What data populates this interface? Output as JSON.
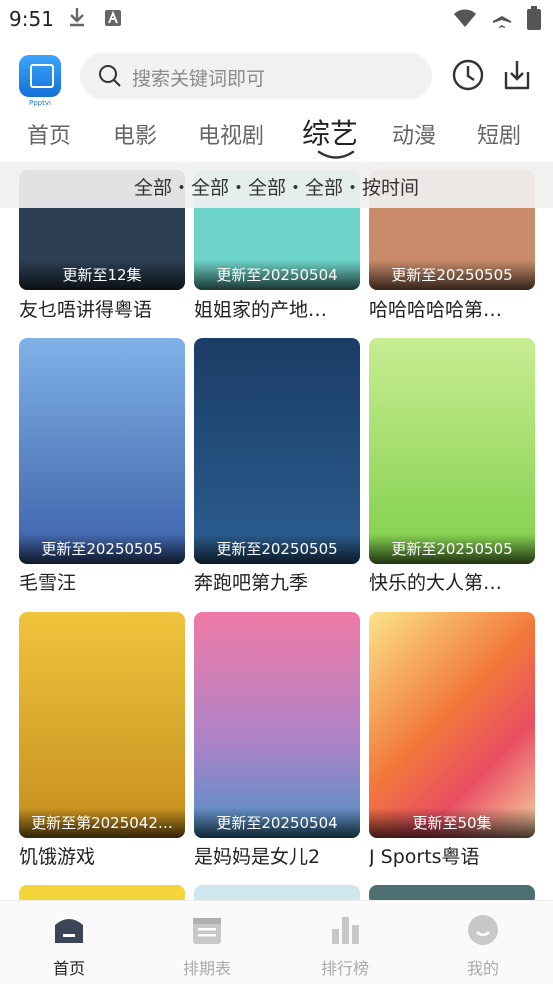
{
  "status": {
    "time": "9:51"
  },
  "header": {
    "logo_caption": "Ppptvi",
    "search_placeholder": "搜索关键词即可"
  },
  "tabs": [
    {
      "label": "首页",
      "active": false
    },
    {
      "label": "电影",
      "active": false
    },
    {
      "label": "电视剧",
      "active": false
    },
    {
      "label": "综艺",
      "active": true
    },
    {
      "label": "动漫",
      "active": false
    },
    {
      "label": "短剧",
      "active": false
    }
  ],
  "filter": {
    "text": "全部・全部・全部・全部・按时间"
  },
  "rows": [
    [
      {
        "badge": "更新至12集",
        "title": "友乜唔讲得粤语",
        "color": "#2d3f55"
      },
      {
        "badge": "更新至20250504",
        "title": "姐姐家的产地…",
        "color": "#6dd3c8"
      },
      {
        "badge": "更新至20250505",
        "title": "哈哈哈哈哈第…",
        "color": "#c98b6a"
      }
    ],
    [
      {
        "badge": "更新至20250505",
        "title": "毛雪汪",
        "color": "#5a86c8"
      },
      {
        "badge": "更新至20250505",
        "title": "奔跑吧第九季",
        "color": "#1c3b63"
      },
      {
        "badge": "更新至20250505",
        "title": "快乐的大人第…",
        "color": "#8ed64d"
      }
    ],
    [
      {
        "badge": "更新至第2025042…",
        "title": "饥饿游戏",
        "color": "#d8a631"
      },
      {
        "badge": "更新至20250504",
        "title": "是妈妈是女儿2",
        "color": "#e889a8"
      },
      {
        "badge": "更新至50集",
        "title": "J Sports粤语",
        "color": "#f08a3a"
      }
    ]
  ],
  "nav": [
    {
      "label": "首页",
      "icon": "home-icon",
      "active": true
    },
    {
      "label": "排期表",
      "icon": "calendar-icon",
      "active": false
    },
    {
      "label": "排行榜",
      "icon": "bar-chart-icon",
      "active": false
    },
    {
      "label": "我的",
      "icon": "profile-icon",
      "active": false
    }
  ]
}
